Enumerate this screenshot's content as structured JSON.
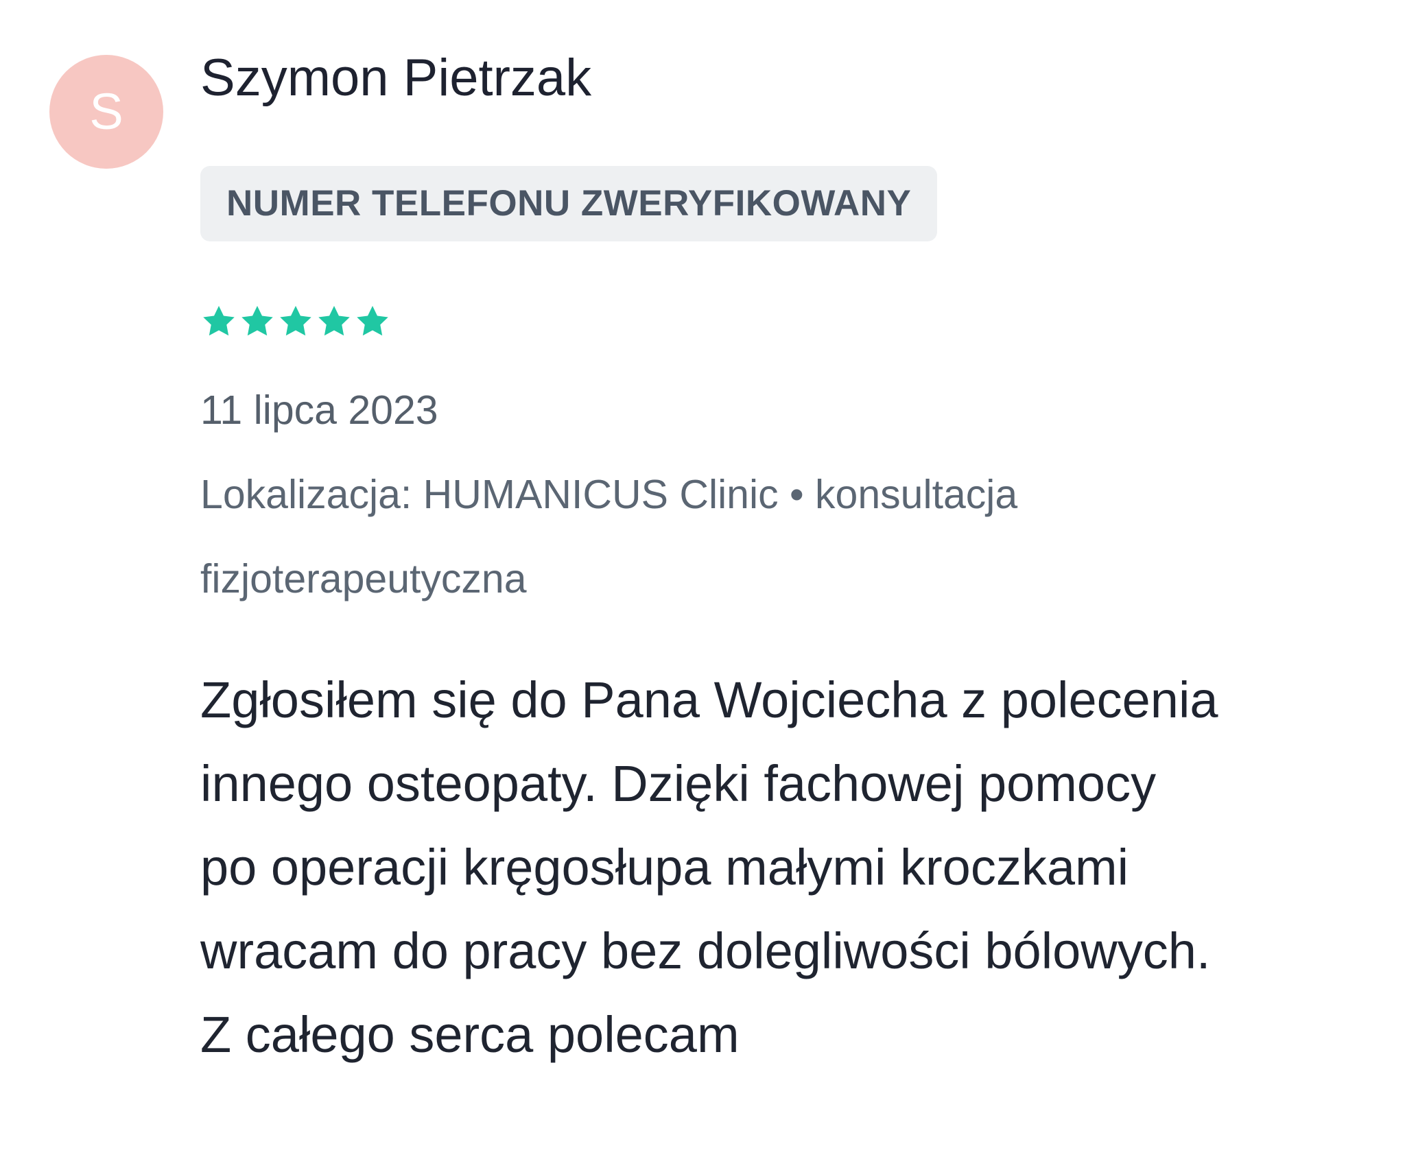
{
  "reviewer": {
    "avatar_initial": "S",
    "name": "Szymon Pietrzak",
    "avatar_color": "#f7c7c2"
  },
  "badge": {
    "label": "NUMER TELEFONU ZWERYFIKOWANY"
  },
  "rating": {
    "stars": 5,
    "max_stars": 5,
    "star_color": "#20c7a3"
  },
  "review": {
    "date": "11 lipca 2023",
    "location_line_1": "Lokalizacja: HUMANICUS Clinic • konsultacja",
    "location_line_2": "fizjoterapeutyczna",
    "text_line_1": "Zgłosiłem się do Pana Wojciecha z polecenia",
    "text_line_2": "innego osteopaty. Dzięki fachowej pomocy",
    "text_line_3": "po operacji kręgosłupa małymi kroczkami",
    "text_line_4": "wracam do pracy bez dolegliwości bólowych.",
    "text_line_5": "Z całego serca polecam"
  }
}
